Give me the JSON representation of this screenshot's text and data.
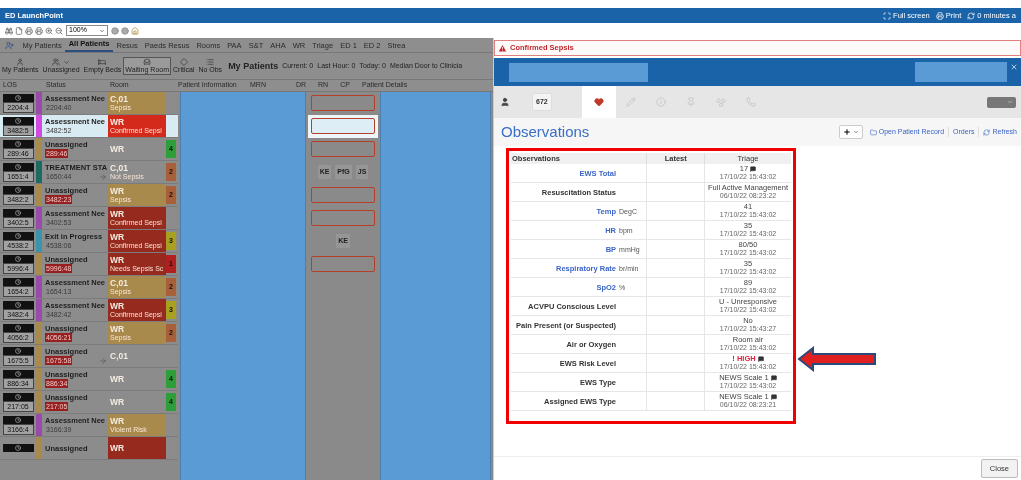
{
  "window": {
    "title": "ED LaunchPoint",
    "actions": [
      {
        "kind": "fullscreen",
        "label": "Full screen"
      },
      {
        "kind": "print",
        "label": "Print"
      },
      {
        "kind": "refresh",
        "label": "0 minutes a"
      }
    ]
  },
  "toolbar": {
    "zoom": "100%"
  },
  "tabs": [
    {
      "label": "My Patients",
      "selected": false
    },
    {
      "label": "All Patients",
      "selected": true
    },
    {
      "label": "Resus",
      "selected": false
    },
    {
      "label": "Paeds Resus",
      "selected": false
    },
    {
      "label": "Rooms",
      "selected": false
    },
    {
      "label": "PAA",
      "selected": false
    },
    {
      "label": "S&T",
      "selected": false
    },
    {
      "label": "AHA",
      "selected": false
    },
    {
      "label": "WR",
      "selected": false
    },
    {
      "label": "Triage",
      "selected": false
    },
    {
      "label": "ED 1",
      "selected": false
    },
    {
      "label": "ED 2",
      "selected": false
    },
    {
      "label": "Strea",
      "selected": false
    }
  ],
  "filters": [
    {
      "kind": "person",
      "label": "My Patients",
      "selected": false,
      "dropdown": false
    },
    {
      "kind": "people",
      "label": "Unassigned",
      "selected": false,
      "dropdown": true
    },
    {
      "kind": "bed",
      "label": "Empty Beds",
      "selected": false,
      "dropdown": false
    },
    {
      "kind": "chair",
      "label": "Waiting Room",
      "selected": true,
      "dropdown": false
    },
    {
      "kind": "diamond",
      "label": "Critical",
      "selected": false,
      "dropdown": false
    },
    {
      "kind": "list",
      "label": "No Obs",
      "selected": false,
      "dropdown": false
    }
  ],
  "summary": {
    "title": "My Patients",
    "stats": [
      "Current: 0",
      "Last Hour: 0",
      "Today: 0",
      "Median Door to Clinicia"
    ]
  },
  "columns": [
    "LOS",
    "Status",
    "Room",
    "Patient Information",
    "MRN",
    "DR",
    "RN",
    "CP",
    "Patient Details"
  ],
  "rows": [
    {
      "los": "2204:4",
      "color": "#9a4aa8",
      "status": "Assessment Nee",
      "sub": "2204:40",
      "sub_badge": false,
      "room": {
        "text": "C,01",
        "note": "Sepsis",
        "color": "#a88a4c"
      },
      "selected": false,
      "transfer": false,
      "staff": {
        "kind": "box"
      }
    },
    {
      "los": "3482:5",
      "color": "#d24ae0",
      "status": "Assessment Nee",
      "sub": "3482:52",
      "sub_badge": false,
      "room": {
        "text": "WR",
        "note": "Confirmed Sepsi",
        "color": "#d42a1c"
      },
      "selected": true,
      "transfer": false,
      "staff": {
        "kind": "box"
      }
    },
    {
      "los": "289:46",
      "color": "#a88a4c",
      "status": "Unassigned",
      "sub": "289:46",
      "sub_badge": true,
      "room": {
        "text": "WR",
        "color": "#8c8c8c"
      },
      "acuity": {
        "value": "4",
        "color": "#2e9e3a"
      },
      "selected": false,
      "transfer": false,
      "staff": {
        "kind": "box"
      }
    },
    {
      "los": "1651:4",
      "color": "#1e6a60",
      "status": "TREATMENT STA",
      "sub": "1650:44",
      "sub_badge": false,
      "room": {
        "text": "C,01",
        "note": "Not Sepsis",
        "color": "#8c8c8c"
      },
      "acuity": {
        "value": "2",
        "color": "#a8603a"
      },
      "selected": false,
      "transfer": true,
      "staff": {
        "kind": "initials",
        "initials": [
          "KE",
          "PfG",
          "JS"
        ]
      }
    },
    {
      "los": "3482:2",
      "color": "#a88a4c",
      "status": "Unassigned",
      "sub": "3482:23",
      "sub_badge": true,
      "room": {
        "text": "WR",
        "note": "Sepsis",
        "color": "#a88a4c"
      },
      "acuity": {
        "value": "2",
        "color": "#a8603a"
      },
      "selected": false,
      "transfer": false,
      "staff": {
        "kind": "box"
      }
    },
    {
      "los": "3402:5",
      "color": "#9a4aa8",
      "status": "Assessment Nee",
      "sub": "3402:53",
      "sub_badge": false,
      "room": {
        "text": "WR",
        "note": "Confirmed Sepsi",
        "color": "#962a1e"
      },
      "selected": false,
      "transfer": false,
      "staff": {
        "kind": "box"
      }
    },
    {
      "los": "4538:2",
      "color": "#3a94ac",
      "status": "Exit in Progress",
      "sub": "4538:06",
      "sub_badge": false,
      "room": {
        "text": "WR",
        "note": "Confirmed Sepsi",
        "color": "#962a1e"
      },
      "acuity": {
        "value": "3",
        "color": "#a8a020"
      },
      "selected": false,
      "transfer": false,
      "staff": {
        "kind": "initials",
        "initials": [
          "KE"
        ]
      }
    },
    {
      "los": "5996:4",
      "color": "#a88a4c",
      "status": "Unassigned",
      "sub": "5996:48",
      "sub_badge": true,
      "room": {
        "text": "WR",
        "note": "Needs Sepsis Sc",
        "color": "#962a1e"
      },
      "acuity": {
        "value": "1",
        "color": "#b02020"
      },
      "selected": false,
      "transfer": false,
      "staff": {
        "kind": "box"
      }
    },
    {
      "los": "1654:2",
      "color": "#9a4aa8",
      "status": "Assessment Nee",
      "sub": "1654:13",
      "sub_badge": false,
      "room": {
        "text": "C,01",
        "note": "Sepsis",
        "color": "#a88a4c"
      },
      "acuity": {
        "value": "2",
        "color": "#a8603a"
      },
      "selected": false,
      "transfer": false
    },
    {
      "los": "3482:4",
      "color": "#9a4aa8",
      "status": "Assessment Nee",
      "sub": "3482:42",
      "sub_badge": false,
      "room": {
        "text": "WR",
        "note": "Confirmed Sepsi",
        "color": "#962a1e"
      },
      "acuity": {
        "value": "3",
        "color": "#a8a020"
      },
      "selected": false,
      "transfer": false
    },
    {
      "los": "4056:2",
      "color": "#a88a4c",
      "status": "Unassigned",
      "sub": "4056:21",
      "sub_badge": true,
      "room": {
        "text": "WR",
        "note": "Sepsis",
        "color": "#a88a4c"
      },
      "acuity": {
        "value": "2",
        "color": "#a8603a"
      },
      "selected": false,
      "transfer": false
    },
    {
      "los": "1675:5",
      "color": "#a88a4c",
      "status": "Unassigned",
      "sub": "1675:58",
      "sub_badge": true,
      "room": {
        "text": "C,01",
        "color": "#8c8c8c"
      },
      "selected": false,
      "transfer": true
    },
    {
      "los": "886:34",
      "color": "#a88a4c",
      "status": "Unassigned",
      "sub": "886:34",
      "sub_badge": true,
      "room": {
        "text": "WR",
        "color": "#8c8c8c"
      },
      "acuity": {
        "value": "4",
        "color": "#2e9e3a"
      },
      "selected": false,
      "transfer": false
    },
    {
      "los": "217:05",
      "color": "#a88a4c",
      "status": "Unassigned",
      "sub": "217:05",
      "sub_badge": true,
      "room": {
        "text": "WR",
        "color": "#8c8c8c"
      },
      "acuity": {
        "value": "4",
        "color": "#2e9e3a"
      },
      "selected": false,
      "transfer": false
    },
    {
      "los": "3166:4",
      "color": "#9a4aa8",
      "status": "Assessment Nee",
      "sub": "3166:39",
      "sub_badge": false,
      "room": {
        "text": "WR",
        "note": "Violent Risk",
        "color": "#a88a4c"
      },
      "selected": false,
      "transfer": false
    },
    {
      "color": "#a88a4c",
      "status": "Unassigned",
      "room": {
        "text": "WR",
        "color": "#962a1e"
      },
      "selected": false,
      "transfer": false
    }
  ],
  "alert": {
    "text": "Confirmed Sepsis"
  },
  "panel_tabs": [
    {
      "kind": "person",
      "badge": "672",
      "selected": false
    },
    {
      "kind": "heart",
      "selected": true
    },
    {
      "kind": "pencil",
      "selected": false
    },
    {
      "kind": "info",
      "selected": false
    },
    {
      "kind": "pin",
      "selected": false
    },
    {
      "kind": "radiation",
      "selected": false
    },
    {
      "kind": "phone",
      "selected": false
    }
  ],
  "observations": {
    "title": "Observations",
    "actions": [
      {
        "kind": "folder",
        "label": "Open Patient Record"
      },
      {
        "kind": "text",
        "label": "Orders"
      },
      {
        "kind": "refresh",
        "label": "Refresh"
      }
    ],
    "columns": [
      "Observations",
      "Latest",
      "Triage"
    ],
    "rows": [
      {
        "label": "EWS Total",
        "link": true,
        "value": "17",
        "time": "17/10/22 15:43:02",
        "comment": true,
        "alert": false
      },
      {
        "label": "Resuscitation Status",
        "link": false,
        "value": "Full Active Management",
        "time": "06/10/22 08:23:22",
        "comment": false,
        "alert": false
      },
      {
        "label": "Temp",
        "unit": "DegC",
        "link": true,
        "value": "41",
        "time": "17/10/22 15:43:02",
        "comment": false,
        "alert": false
      },
      {
        "label": "HR",
        "unit": "bpm",
        "link": true,
        "value": "35",
        "time": "17/10/22 15:43:02",
        "comment": false,
        "alert": false
      },
      {
        "label": "BP",
        "unit": "mmHg",
        "link": true,
        "value": "80/50",
        "time": "17/10/22 15:43:02",
        "comment": false,
        "alert": false
      },
      {
        "label": "Respiratory Rate",
        "unit": "br/min",
        "link": true,
        "value": "35",
        "time": "17/10/22 15:43:02",
        "comment": false,
        "alert": false
      },
      {
        "label": "SpO2",
        "unit": "%",
        "link": true,
        "value": "89",
        "time": "17/10/22 15:43:02",
        "comment": false,
        "alert": false
      },
      {
        "label": "ACVPU Conscious Level",
        "link": false,
        "value": "U - Unresponsive",
        "time": "17/10/22 15:43:02",
        "comment": false,
        "alert": false
      },
      {
        "label": "Pain Present (or Suspected)",
        "link": false,
        "value": "No",
        "time": "17/10/22 15:43:27",
        "comment": false,
        "alert": false
      },
      {
        "label": "Air or Oxygen",
        "link": false,
        "value": "Room air",
        "time": "17/10/22 15:43:02",
        "comment": false,
        "alert": false
      },
      {
        "label": "EWS Risk Level",
        "link": false,
        "value": "! HIGH",
        "time": "17/10/22 15:43:02",
        "comment": true,
        "alert": true
      },
      {
        "label": "EWS Type",
        "link": false,
        "value": "NEWS Scale 1",
        "time": "17/10/22 15:43:02",
        "comment": true,
        "alert": false
      },
      {
        "label": "Assigned EWS Type",
        "link": false,
        "value": "NEWS Scale 1",
        "time": "06/10/22 08:23:21",
        "comment": true,
        "alert": false
      }
    ]
  },
  "close_button": "Close"
}
